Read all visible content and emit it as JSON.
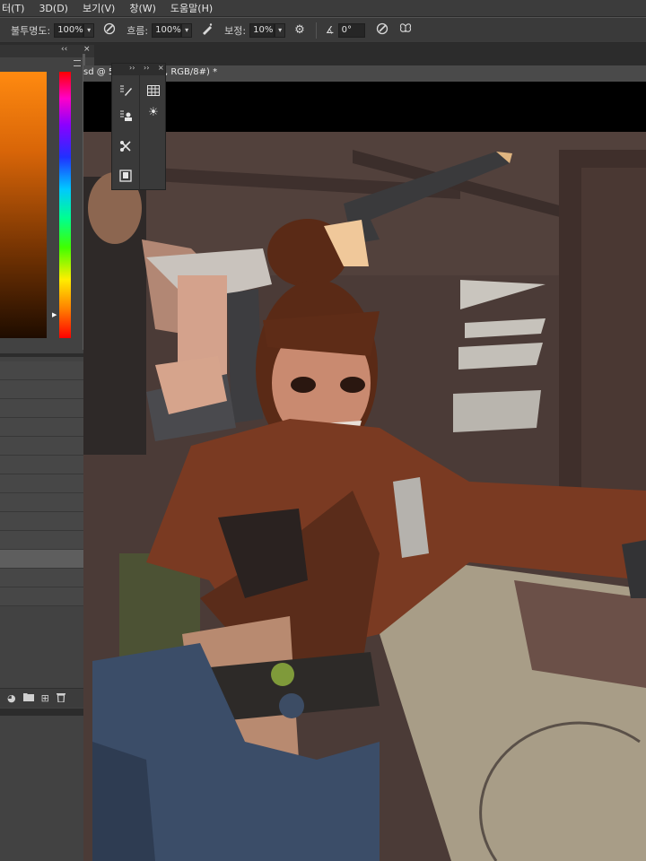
{
  "menu": [
    "터(T)",
    "3D(D)",
    "보기(V)",
    "창(W)",
    "도움말(H)"
  ],
  "options": {
    "opacity_label": "불투명도:",
    "opacity_value": "100%",
    "flow_label": "흐름:",
    "flow_value": "100%",
    "smoothing_label": "보정:",
    "smoothing_value": "10%",
    "angle_value": "0°"
  },
  "document_tab": {
    "part1": "sd @ 58",
    "part2": ", RGB/8#) *"
  },
  "layers_panel": {
    "row_count": 13,
    "selected_row": 10
  },
  "colors": {
    "app_bg": "#535353",
    "panel_bg": "#424242",
    "canvas_bg": "#4a3a36",
    "jacket": "#7a3a22",
    "hair": "#5a2a16"
  },
  "icons": [
    "airbrush-icon",
    "pressure-opacity-icon",
    "settings-gear-icon",
    "angle-icon",
    "pressure-size-icon",
    "symmetry-butterfly-icon",
    "brush-tool-icon",
    "grid-table-icon",
    "clone-stamp-icon",
    "sun-adjust-icon",
    "tool-presets-icon",
    "notes-icon",
    "new-group-icon",
    "folder-icon",
    "new-layer-icon",
    "trash-icon"
  ]
}
